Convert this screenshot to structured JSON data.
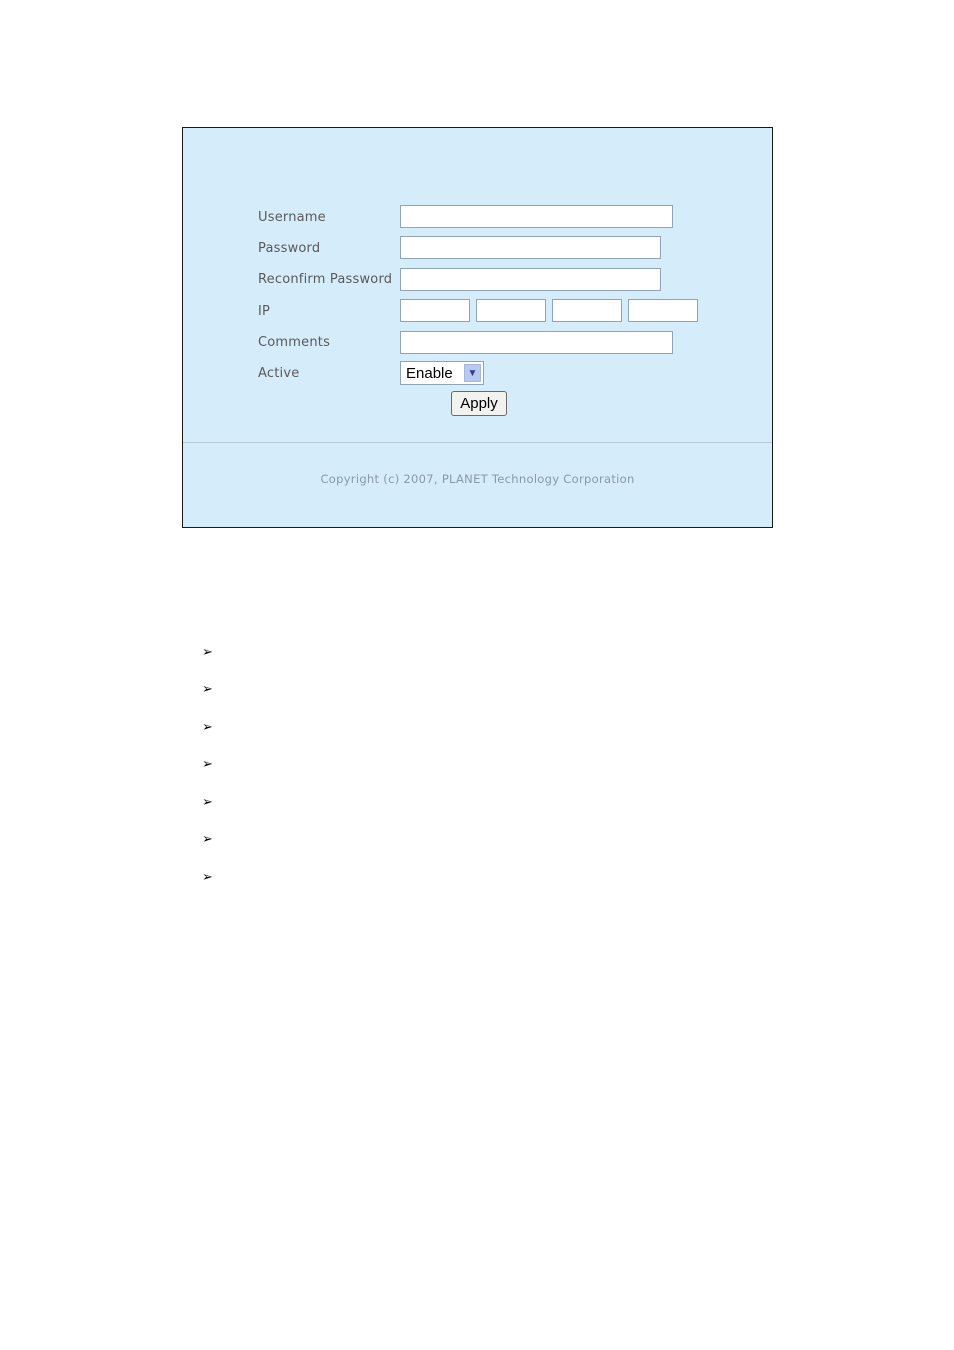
{
  "form": {
    "fields": [
      {
        "label": "Username",
        "value": ""
      },
      {
        "label": "Password",
        "value": ""
      },
      {
        "label": "Reconfirm Password",
        "value": ""
      },
      {
        "label": "IP",
        "octets": [
          "",
          "",
          "",
          ""
        ]
      },
      {
        "label": "Comments",
        "value": ""
      },
      {
        "label": "Active",
        "selected": "Enable"
      }
    ],
    "apply_label": "Apply"
  },
  "footer": {
    "copyright": "Copyright (c) 2007, PLANET Technology Corporation"
  },
  "bullets": {
    "icon": "arrowhead-bullet-icon",
    "glyph": "➢",
    "count": 7
  }
}
